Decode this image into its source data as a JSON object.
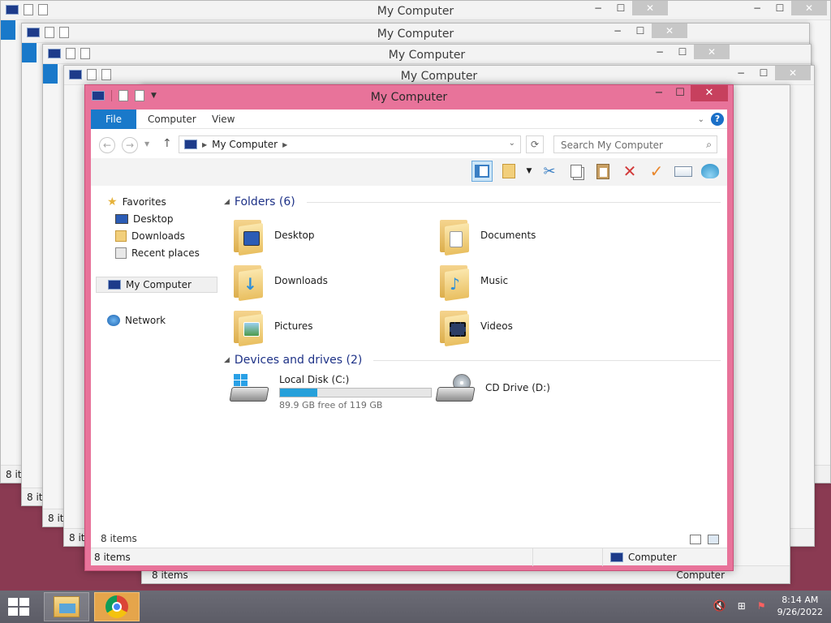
{
  "window": {
    "title": "My Computer",
    "minimize": "−",
    "maximize": "☐",
    "close": "✕"
  },
  "ribbon": {
    "tabs": [
      "File",
      "Computer",
      "View"
    ],
    "help": "?"
  },
  "address": {
    "location": "My Computer",
    "search_placeholder": "Search My Computer"
  },
  "nav": {
    "favorites_label": "Favorites",
    "favorites": [
      "Desktop",
      "Downloads",
      "Recent places"
    ],
    "computer": "My Computer",
    "network": "Network"
  },
  "folders_group": {
    "header": "Folders (6)",
    "items": [
      "Desktop",
      "Documents",
      "Downloads",
      "Music",
      "Pictures",
      "Videos"
    ]
  },
  "drives_group": {
    "header": "Devices and drives (2)",
    "local_disk": {
      "name": "Local Disk (C:)",
      "free_text": "89.9 GB free of 119 GB",
      "used_fraction": 0.245
    },
    "cd_drive": {
      "name": "CD Drive (D:)"
    }
  },
  "status": {
    "items_inner": "8 items",
    "items": "8 items",
    "location": "Computer"
  },
  "bg_windows": {
    "title": "My Computer",
    "items": "8 it",
    "status_items": "8 items",
    "status_location": "Computer",
    "status_location_short": "uter"
  },
  "taskbar": {
    "time": "8:14 AM",
    "date": "9/26/2022"
  },
  "colors": {
    "accent": "#1979ca",
    "frame": "#e8739a",
    "close": "#c7405e",
    "progress": "#26a0da",
    "group_header": "#1e3287"
  }
}
